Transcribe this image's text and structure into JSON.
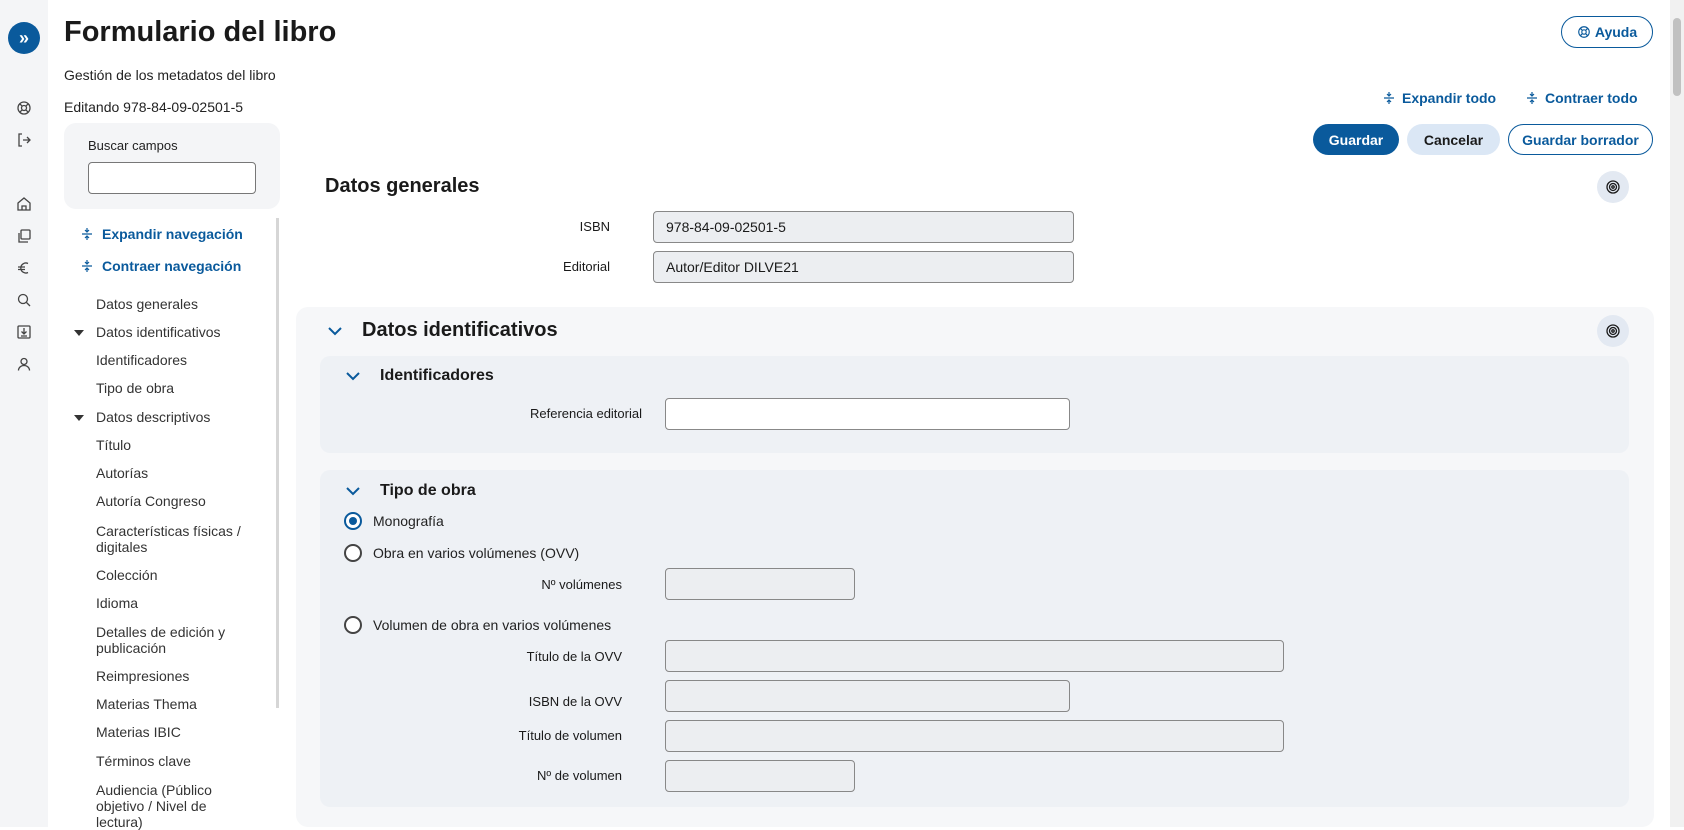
{
  "page": {
    "title": "Formulario del libro",
    "subtitle": "Gestión de los metadatos del libro",
    "editing": "Editando 978-84-09-02501-5"
  },
  "help": {
    "label": "Ayuda"
  },
  "search": {
    "label": "Buscar campos",
    "value": ""
  },
  "nav_links": {
    "expand": "Expandir navegación",
    "collapse": "Contraer navegación"
  },
  "nav_items": [
    {
      "label": "Datos generales"
    },
    {
      "label": "Datos identificativos"
    },
    {
      "label": "Identificadores"
    },
    {
      "label": "Tipo de obra"
    },
    {
      "label": "Datos descriptivos"
    },
    {
      "label": "Título"
    },
    {
      "label": "Autorías"
    },
    {
      "label": "Autoría Congreso"
    },
    {
      "label": "Características físicas / digitales"
    },
    {
      "label": "Colección"
    },
    {
      "label": "Idioma"
    },
    {
      "label": "Detalles de edición y publicación"
    },
    {
      "label": "Reimpresiones"
    },
    {
      "label": "Materias Thema"
    },
    {
      "label": "Materias IBIC"
    },
    {
      "label": "Términos clave"
    },
    {
      "label": "Audiencia (Público objetivo / Nivel de lectura)"
    }
  ],
  "actions": {
    "expand_all": "Expandir todo",
    "collapse_all": "Contraer todo",
    "save": "Guardar",
    "cancel": "Cancelar",
    "save_draft": "Guardar borrador"
  },
  "general": {
    "title": "Datos generales",
    "isbn_label": "ISBN",
    "isbn_value": "978-84-09-02501-5",
    "publisher_label": "Editorial",
    "publisher_value": "Autor/Editor DILVE21"
  },
  "identification": {
    "title": "Datos identificativos",
    "identifiers": {
      "title": "Identificadores",
      "ref_label": "Referencia editorial",
      "ref_value": ""
    },
    "work_type": {
      "title": "Tipo de obra",
      "options": [
        "Monografía",
        "Obra en varios volúmenes (OVV)",
        "Volumen de obra en varios volúmenes"
      ],
      "selected": "Monografía",
      "num_volumes_label": "Nº volúmenes",
      "ovv_title_label": "Título de la OVV",
      "ovv_isbn_label": "ISBN de la OVV",
      "volume_title_label": "Título de volumen",
      "volume_number_label": "Nº de volumen"
    }
  },
  "colors": {
    "accent": "#0a5a9c",
    "panel": "#f6f7f9",
    "input_disabled": "#eceef1"
  },
  "icons": {
    "rail": [
      "lifebuoy-icon",
      "logout-icon",
      "home-icon",
      "books-icon",
      "euro-icon",
      "search-icon",
      "download-icon",
      "user-icon"
    ]
  }
}
